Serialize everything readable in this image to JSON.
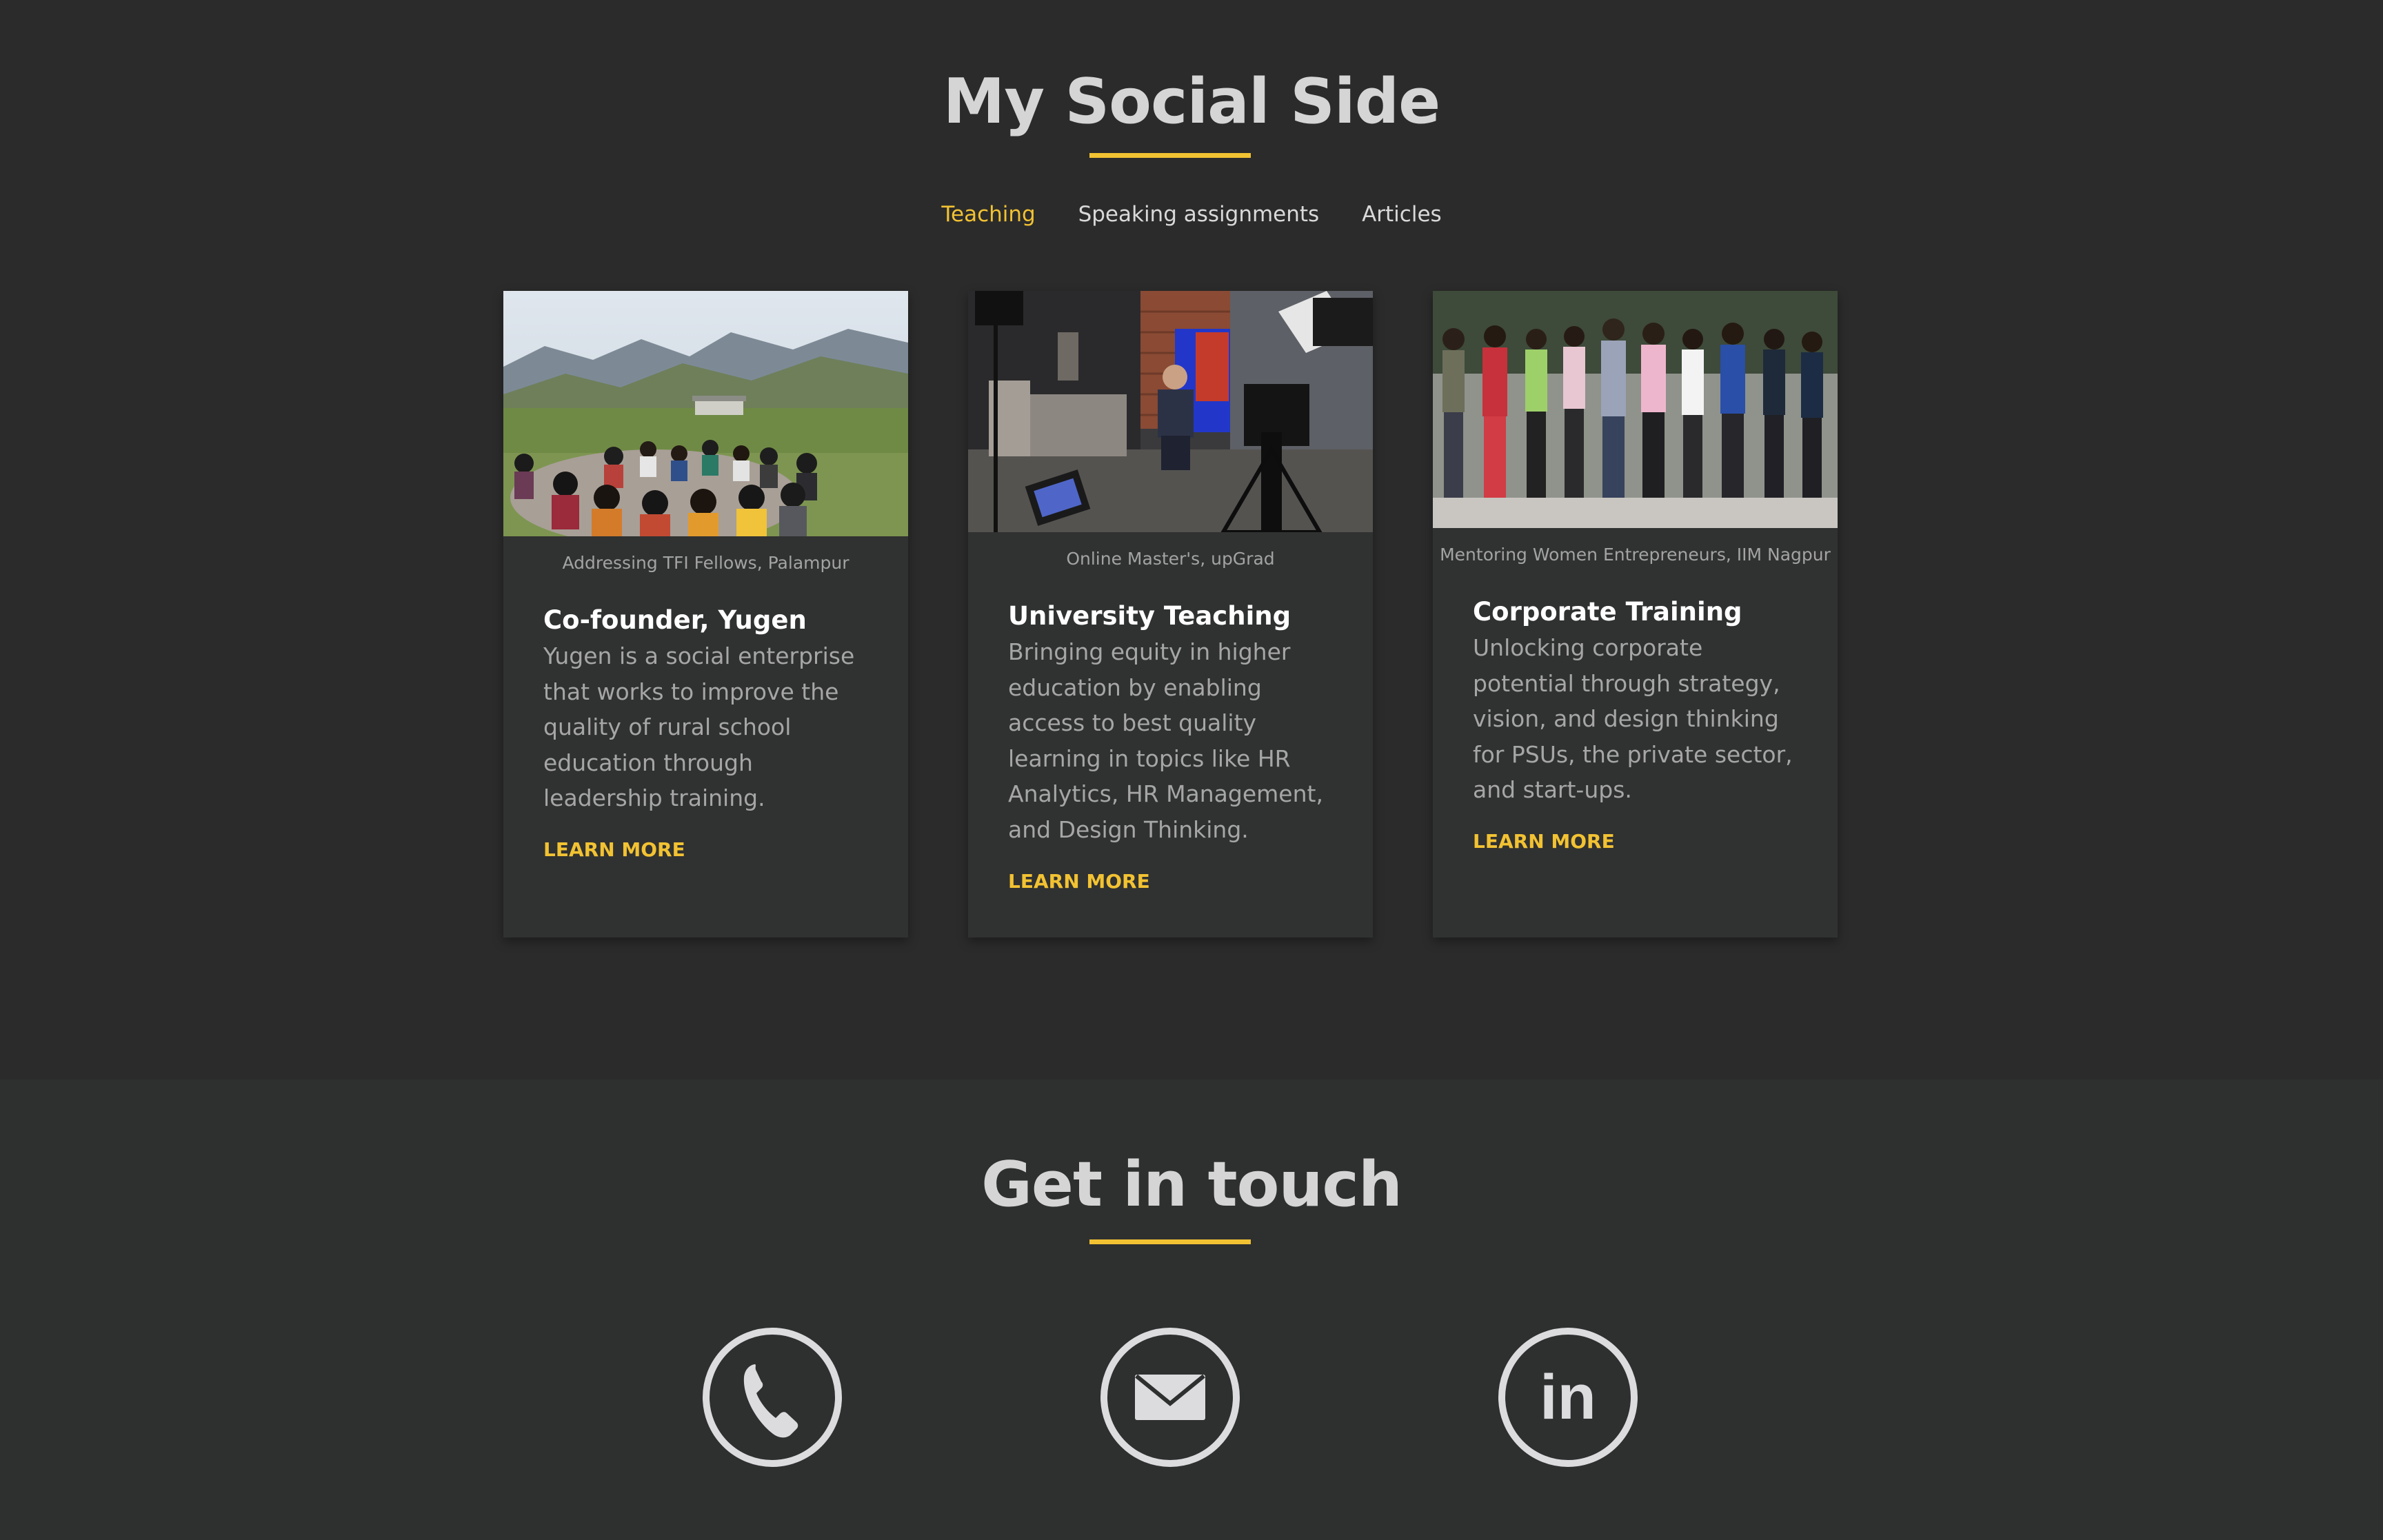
{
  "social": {
    "heading": "My Social Side",
    "tabs": [
      "Teaching",
      "Speaking assignments",
      "Articles"
    ],
    "active_tab": "Teaching"
  },
  "cards": [
    {
      "caption": "Addressing TFI Fellows, Palampur",
      "title": "Co-founder, Yugen",
      "description": "Yugen is a social enterprise that works to improve the quality of rural school education through leadership training.",
      "link": "LEARN MORE"
    },
    {
      "caption": "Online Master's, upGrad",
      "title": "University Teaching",
      "description": "Bringing equity in higher education by enabling access to best quality learning in topics like HR Analytics, HR Management, and Design Thinking.",
      "link": "LEARN MORE"
    },
    {
      "caption": "Mentoring Women Entrepreneurs, IIM Nagpur",
      "title": "Corporate Training",
      "description": "Unlocking corporate potential through strategy, vision, and design thinking for PSUs, the private sector, and start-ups.",
      "link": "LEARN MORE"
    }
  ],
  "contact": {
    "heading": "Get in touch",
    "icons": [
      "phone-icon",
      "email-icon",
      "linkedin-icon"
    ],
    "linkedin_text": "in"
  },
  "colors": {
    "background": "#2b2b2b",
    "card": "#303131",
    "accent": "#f2c232",
    "heading": "#d5d5d5",
    "icon": "#dcdcdf"
  }
}
